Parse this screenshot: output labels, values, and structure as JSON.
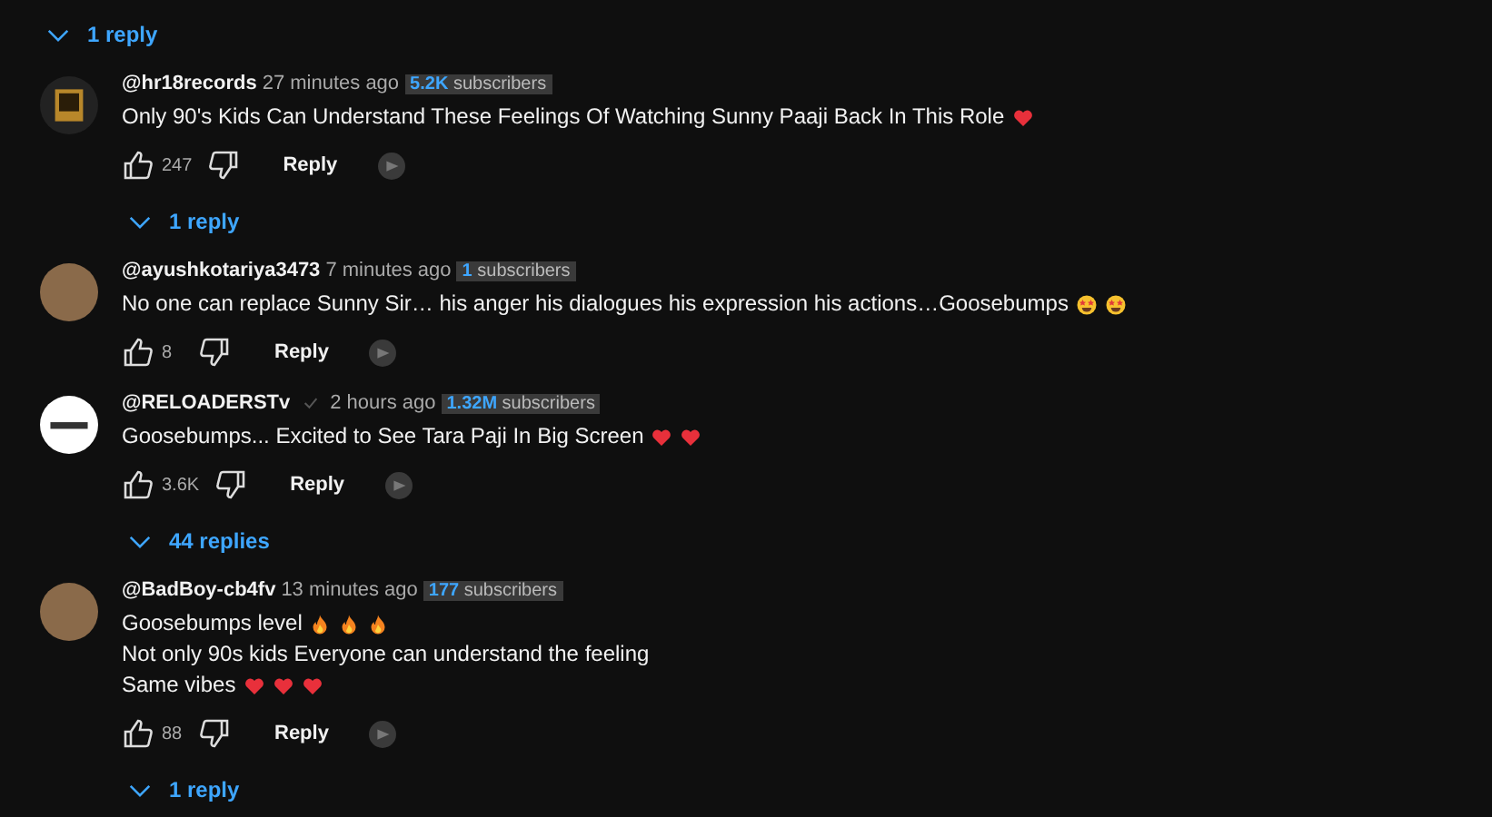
{
  "top_replies": {
    "label": "1 reply"
  },
  "comments": [
    {
      "author": "@hr18records",
      "verified": false,
      "time": "27 minutes ago",
      "sub_count": "5.2K",
      "sub_label": "subscribers",
      "avatar": {
        "kind": "logo"
      },
      "lines": [
        {
          "text": "Only 90's Kids Can Understand These Feelings Of Watching Sunny Paaji Back In This Role",
          "emojis": [
            {
              "kind": "heart"
            }
          ]
        }
      ],
      "likes": "247",
      "reply": "Reply",
      "replies": "1 reply"
    },
    {
      "author": "@ayushkotariya3473",
      "verified": false,
      "time": "7 minutes ago",
      "sub_count": "1",
      "sub_label": "subscribers",
      "avatar": {
        "kind": "photo"
      },
      "lines": [
        {
          "text": "No one can replace Sunny Sir… his anger his dialogues his expression his actions…Goosebumps",
          "emojis": [
            {
              "kind": "star-eyes"
            },
            {
              "kind": "star-eyes"
            }
          ]
        }
      ],
      "likes": "8",
      "reply": "Reply"
    },
    {
      "author": "@RELOADERSTv",
      "verified": true,
      "time": "2 hours ago",
      "sub_count": "1.32M",
      "sub_label": "subscribers",
      "avatar": {
        "kind": "white"
      },
      "lines": [
        {
          "text": "Goosebumps... Excited to See Tara Paji In Big Screen",
          "emojis": [
            {
              "kind": "heart"
            },
            {
              "kind": "heart"
            }
          ]
        }
      ],
      "likes": "3.6K",
      "reply": "Reply",
      "replies": "44 replies"
    },
    {
      "author": "@BadBoy-cb4fv",
      "verified": false,
      "time": "13 minutes ago",
      "sub_count": "177",
      "sub_label": "subscribers",
      "avatar": {
        "kind": "photo"
      },
      "lines": [
        {
          "text": "Goosebumps level",
          "emojis": [
            {
              "kind": "fire"
            },
            {
              "kind": "fire"
            },
            {
              "kind": "fire"
            }
          ]
        },
        {
          "text": "Not only 90s kids Everyone can understand the feeling"
        },
        {
          "text": "Same vibes",
          "emojis": [
            {
              "kind": "heart"
            },
            {
              "kind": "heart"
            },
            {
              "kind": "heart"
            }
          ]
        }
      ],
      "likes": "88",
      "reply": "Reply",
      "replies": "1 reply"
    }
  ]
}
